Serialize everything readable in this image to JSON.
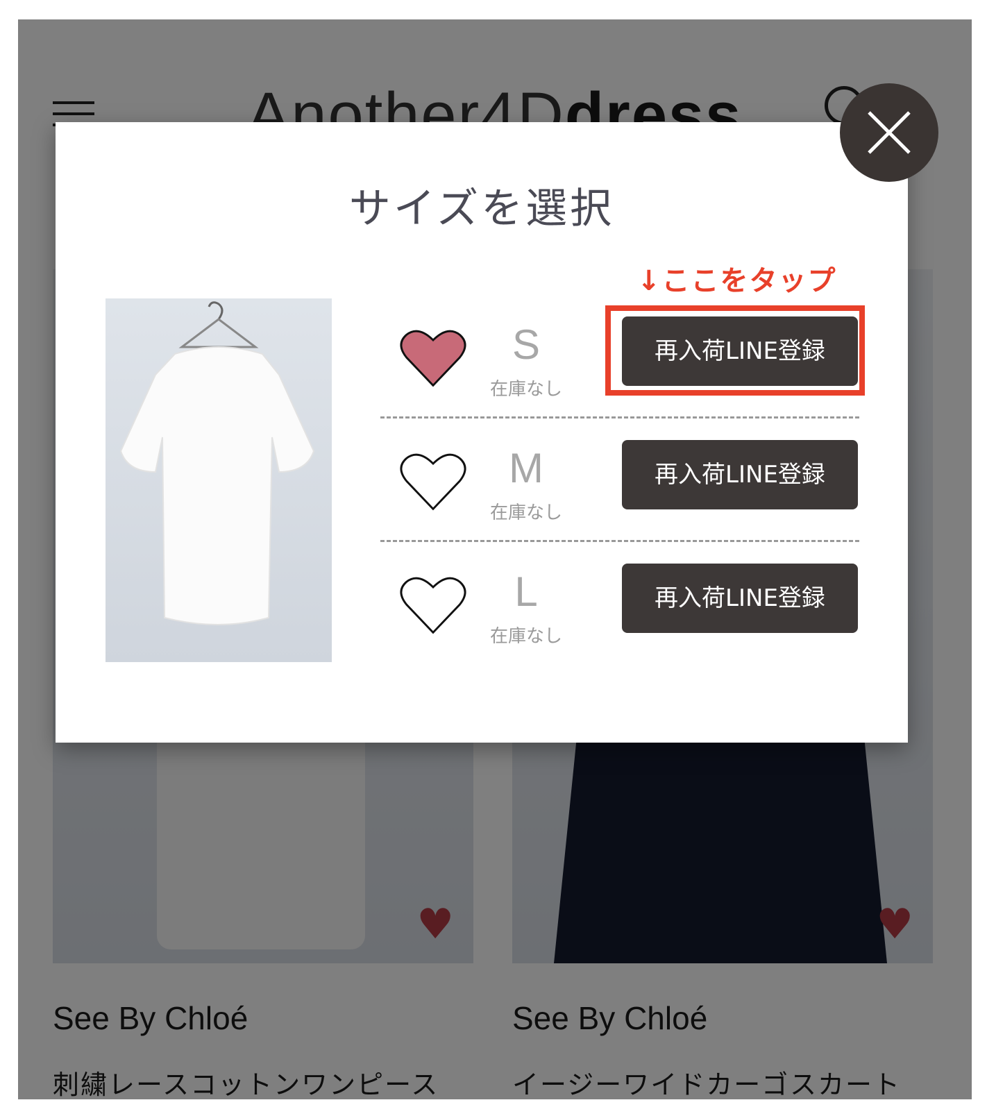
{
  "header": {
    "logo_part1": "Another",
    "logo_part2": "4D",
    "logo_part3": "dress"
  },
  "products": [
    {
      "brand": "See By Chloé",
      "name": "刺繍レースコットンワンピース",
      "favorited": true
    },
    {
      "brand": "See By Chloé",
      "name": "イージーワイドカーゴスカート",
      "favorited": true
    }
  ],
  "modal": {
    "title": "サイズを選択",
    "annotation": "↓ここをタップ",
    "sizes": [
      {
        "size": "S",
        "stock": "在庫なし",
        "button": "再入荷LINE登録",
        "favorited": true
      },
      {
        "size": "M",
        "stock": "在庫なし",
        "button": "再入荷LINE登録",
        "favorited": false
      },
      {
        "size": "L",
        "stock": "在庫なし",
        "button": "再入荷LINE登録",
        "favorited": false
      }
    ]
  },
  "colors": {
    "annotation": "#e8402a",
    "heart_filled": "#c86a78",
    "button_bg": "#3d3837",
    "close_bg": "#3a3432"
  },
  "icons": {
    "menu": "hamburger-icon",
    "search": "search-icon",
    "close": "close-icon",
    "favorite": "heart-icon"
  }
}
